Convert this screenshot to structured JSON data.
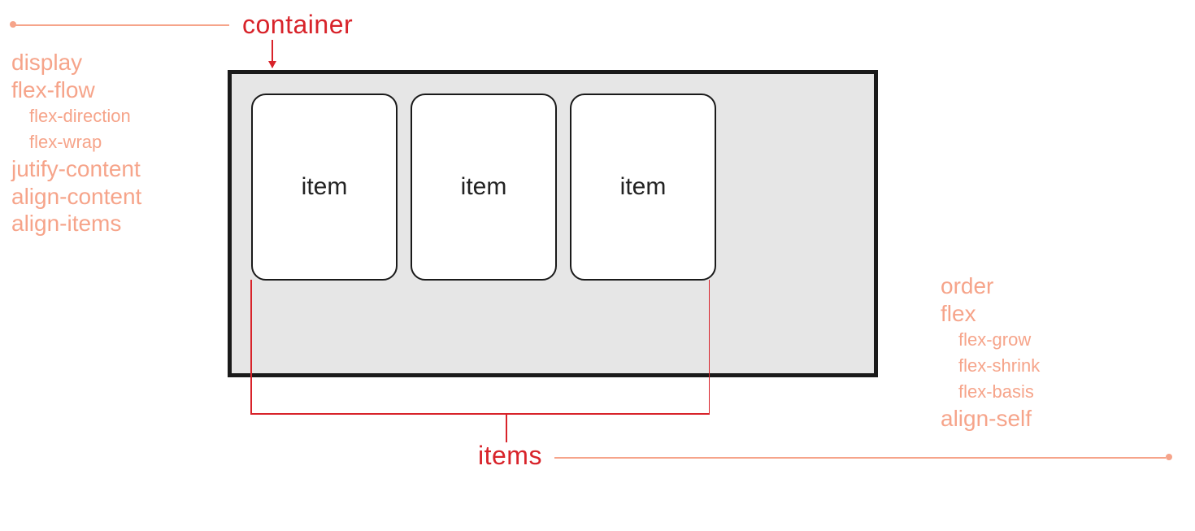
{
  "labels": {
    "container": "container",
    "items": "items",
    "item_text": "item"
  },
  "container_props": {
    "display": "display",
    "flex_flow": "flex-flow",
    "flex_direction": "flex-direction",
    "flex_wrap": "flex-wrap",
    "justify_content": "jutify-content",
    "align_content": "align-content",
    "align_items": "align-items"
  },
  "item_props": {
    "order": "order",
    "flex": "flex",
    "flex_grow": "flex-grow",
    "flex_shrink": "flex-shrink",
    "flex_basis": "flex-basis",
    "align_self": "align-self"
  },
  "colors": {
    "accent_red": "#d8232a",
    "accent_peach": "#f6a48a",
    "container_bg": "#e6e6e6",
    "border": "#1a1a1a"
  }
}
